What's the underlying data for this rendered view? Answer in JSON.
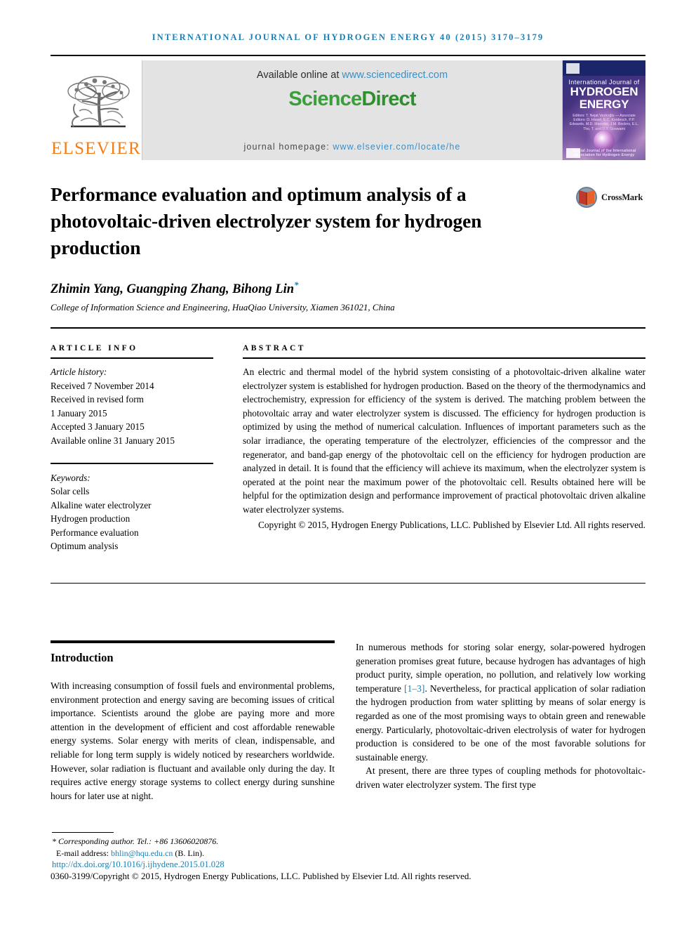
{
  "running_head": "International Journal of Hydrogen Energy 40 (2015) 3170–3179",
  "masthead": {
    "publisher_name": "ELSEVIER",
    "available_prefix": "Available online at ",
    "available_link": "www.sciencedirect.com",
    "sciencedirect_part1": "Science",
    "sciencedirect_part2": "Direct",
    "homepage_prefix": "journal homepage: ",
    "homepage_link": "www.elsevier.com/locate/he",
    "cover": {
      "line1": "International Journal of",
      "line2": "HYDROGEN",
      "line3": "ENERGY",
      "editors": "Editors: T. Nejat Veziroğlu  —  Associate Editors: D. Hissel, E.C. Kordesch, P.P. Edwards, M.D. Mantzke, J.M. Bockris, E.L. Tho, T. and D.Y. Goswami",
      "footer_text": "Official Journal of the International Association for Hydrogen Energy"
    },
    "crossmark_label": "CrossMark"
  },
  "article": {
    "title": "Performance evaluation and optimum analysis of a photovoltaic-driven electrolyzer system for hydrogen production",
    "authors": "Zhimin Yang, Guangping Zhang, Bihong Lin",
    "corresponding_marker": "*",
    "affiliation": "College of Information Science and Engineering, HuaQiao University, Xiamen 361021, China"
  },
  "article_info": {
    "label": "ARTICLE INFO",
    "history_label": "Article history:",
    "history": [
      "Received 7 November 2014",
      "Received in revised form",
      "1 January 2015",
      "Accepted 3 January 2015",
      "Available online 31 January 2015"
    ],
    "keywords_label": "Keywords:",
    "keywords": [
      "Solar cells",
      "Alkaline water electrolyzer",
      "Hydrogen production",
      "Performance evaluation",
      "Optimum analysis"
    ]
  },
  "abstract": {
    "label": "ABSTRACT",
    "text": "An electric and thermal model of the hybrid system consisting of a photovoltaic-driven alkaline water electrolyzer system is established for hydrogen production. Based on the theory of the thermodynamics and electrochemistry, expression for efficiency of the system is derived. The matching problem between the photovoltaic array and water electrolyzer system is discussed. The efficiency for hydrogen production is optimized by using the method of numerical calculation. Influences of important parameters such as the solar irradiance, the operating temperature of the electrolyzer, efficiencies of the compressor and the regenerator, and band-gap energy of the photovoltaic cell on the efficiency for hydrogen production are analyzed in detail. It is found that the efficiency will achieve its maximum, when the electrolyzer system is operated at the point near the maximum power of the photovoltaic cell. Results obtained here will be helpful for the optimization design and performance improvement of practical photovoltaic driven alkaline water electrolyzer systems.",
    "copyright": "Copyright © 2015, Hydrogen Energy Publications, LLC. Published by Elsevier Ltd. All rights reserved."
  },
  "body": {
    "section_heading": "Introduction",
    "left_paragraph": "With increasing consumption of fossil fuels and environmental problems, environment protection and energy saving are becoming issues of critical importance. Scientists around the globe are paying more and more attention in the development of efficient and cost affordable renewable energy systems. Solar energy with merits of clean, indispensable, and reliable for long term supply is widely noticed by researchers worldwide. However, solar radiation is fluctuant and available only during the day. It requires active energy storage systems to collect energy during sunshine hours for later use at night.",
    "right_paragraph_1_a": "In numerous methods for storing solar energy, solar-powered hydrogen generation promises great future, because hydrogen has advantages of high product purity, simple operation, no pollution, and relatively low working temperature ",
    "right_paragraph_1_citation": "[1–3]",
    "right_paragraph_1_b": ". Nevertheless, for practical application of solar radiation the hydrogen production from water splitting by means of solar energy is regarded as one of the most promising ways to obtain green and renewable energy. Particularly, photovoltaic-driven electrolysis of water for hydrogen production is considered to be one of the most favorable solutions for sustainable energy.",
    "right_paragraph_2": "At present, there are three types of coupling methods for photovoltaic-driven water electrolyzer system. The first type"
  },
  "footnotes": {
    "corresponding": "* Corresponding author. Tel.: +86 13606020876.",
    "email_label": "E-mail address: ",
    "email": "bhlin@hqu.edu.cn",
    "email_suffix": " (B. Lin).",
    "doi": "http://dx.doi.org/10.1016/j.ijhydene.2015.01.028",
    "issn_copyright": "0360-3199/Copyright © 2015, Hydrogen Energy Publications, LLC. Published by Elsevier Ltd. All rights reserved."
  },
  "colors": {
    "link_blue": "#1a7fb5",
    "elsevier_orange": "#F07F1A",
    "sciencedirect_green": "#3a9e3a",
    "cover_navy": "#1e2a6e"
  }
}
